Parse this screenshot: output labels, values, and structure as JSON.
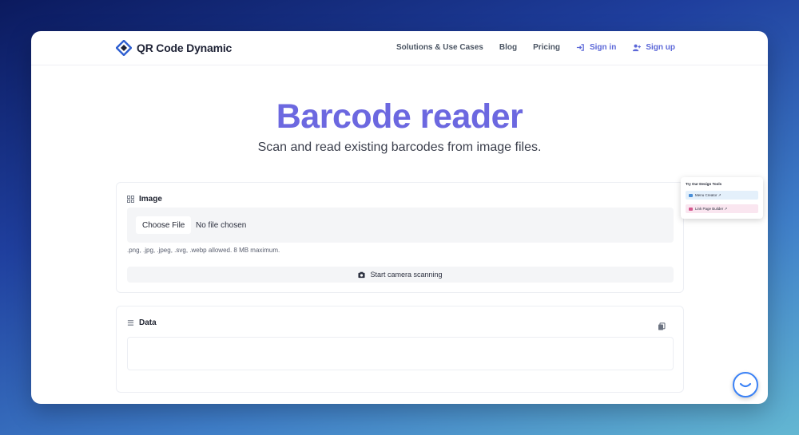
{
  "brand": {
    "name": "QR Code Dynamic"
  },
  "nav": {
    "links": [
      "Solutions & Use Cases",
      "Blog",
      "Pricing"
    ],
    "sign_in": "Sign in",
    "sign_up": "Sign up"
  },
  "hero": {
    "title": "Barcode reader",
    "subtitle": "Scan and read existing barcodes from image files."
  },
  "image_card": {
    "label": "Image",
    "choose_file": "Choose File",
    "no_file": "No file chosen",
    "hint": ".png, .jpg, .jpeg, .svg, .webp allowed. 8 MB maximum.",
    "camera_button": "Start camera scanning"
  },
  "data_card": {
    "label": "Data",
    "value": ""
  },
  "promo": {
    "title": "Try Our Design Tools",
    "items": [
      "Menu Creator ↗",
      "Link Page Builder ↗"
    ]
  },
  "colors": {
    "accent": "#6c68e0",
    "link": "#5b67d8"
  },
  "icons": {
    "logo": "qr-diamond-icon",
    "sign_in": "login-arrow-icon",
    "sign_up": "user-plus-icon",
    "image_section": "grid-icon",
    "camera": "camera-icon",
    "data_section": "list-icon",
    "copy": "copy-icon",
    "chat": "chat-icon"
  }
}
